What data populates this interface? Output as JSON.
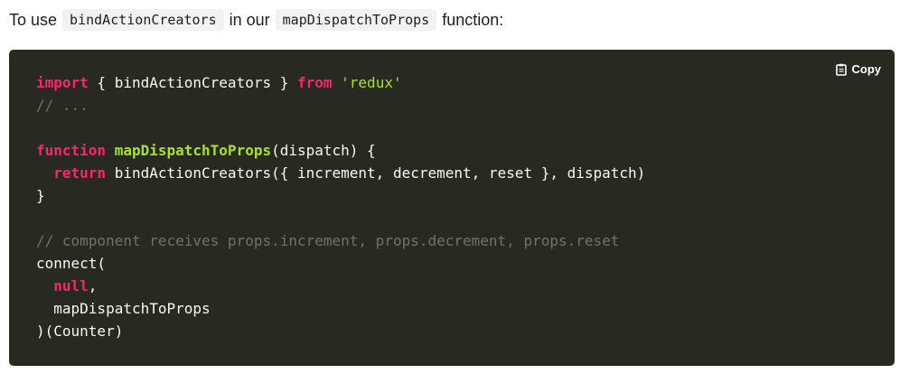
{
  "intro": {
    "before": "To use",
    "code1": "bindActionCreators",
    "middle": "in our",
    "code2": "mapDispatchToProps",
    "after": "function:"
  },
  "copy_button": {
    "label": "Copy",
    "icon": "clipboard-icon"
  },
  "code": {
    "l1_kw_import": "import",
    "l1_text": " { bindActionCreators } ",
    "l1_kw_from": "from",
    "l1_sp": " ",
    "l1_str": "'redux'",
    "l2_comment": "// ...",
    "l4_kw_function": "function",
    "l4_sp": " ",
    "l4_fn": "mapDispatchToProps",
    "l4_text": "(dispatch) {",
    "l5_indent": "  ",
    "l5_kw_return": "return",
    "l5_text": " bindActionCreators({ increment, decrement, reset }, dispatch)",
    "l6_text": "}",
    "l8_comment": "// component receives props.increment, props.decrement, props.reset",
    "l9_text": "connect(",
    "l10_indent": "  ",
    "l10_kw_null": "null",
    "l10_text": ",",
    "l11_text": "  mapDispatchToProps",
    "l12_text": ")(Counter)"
  },
  "colors": {
    "code_background": "#282a22",
    "keyword": "#f92672",
    "function_name": "#a6e22e",
    "string": "#a6e22e",
    "comment": "#75715e",
    "plain": "#f8f8f2"
  }
}
